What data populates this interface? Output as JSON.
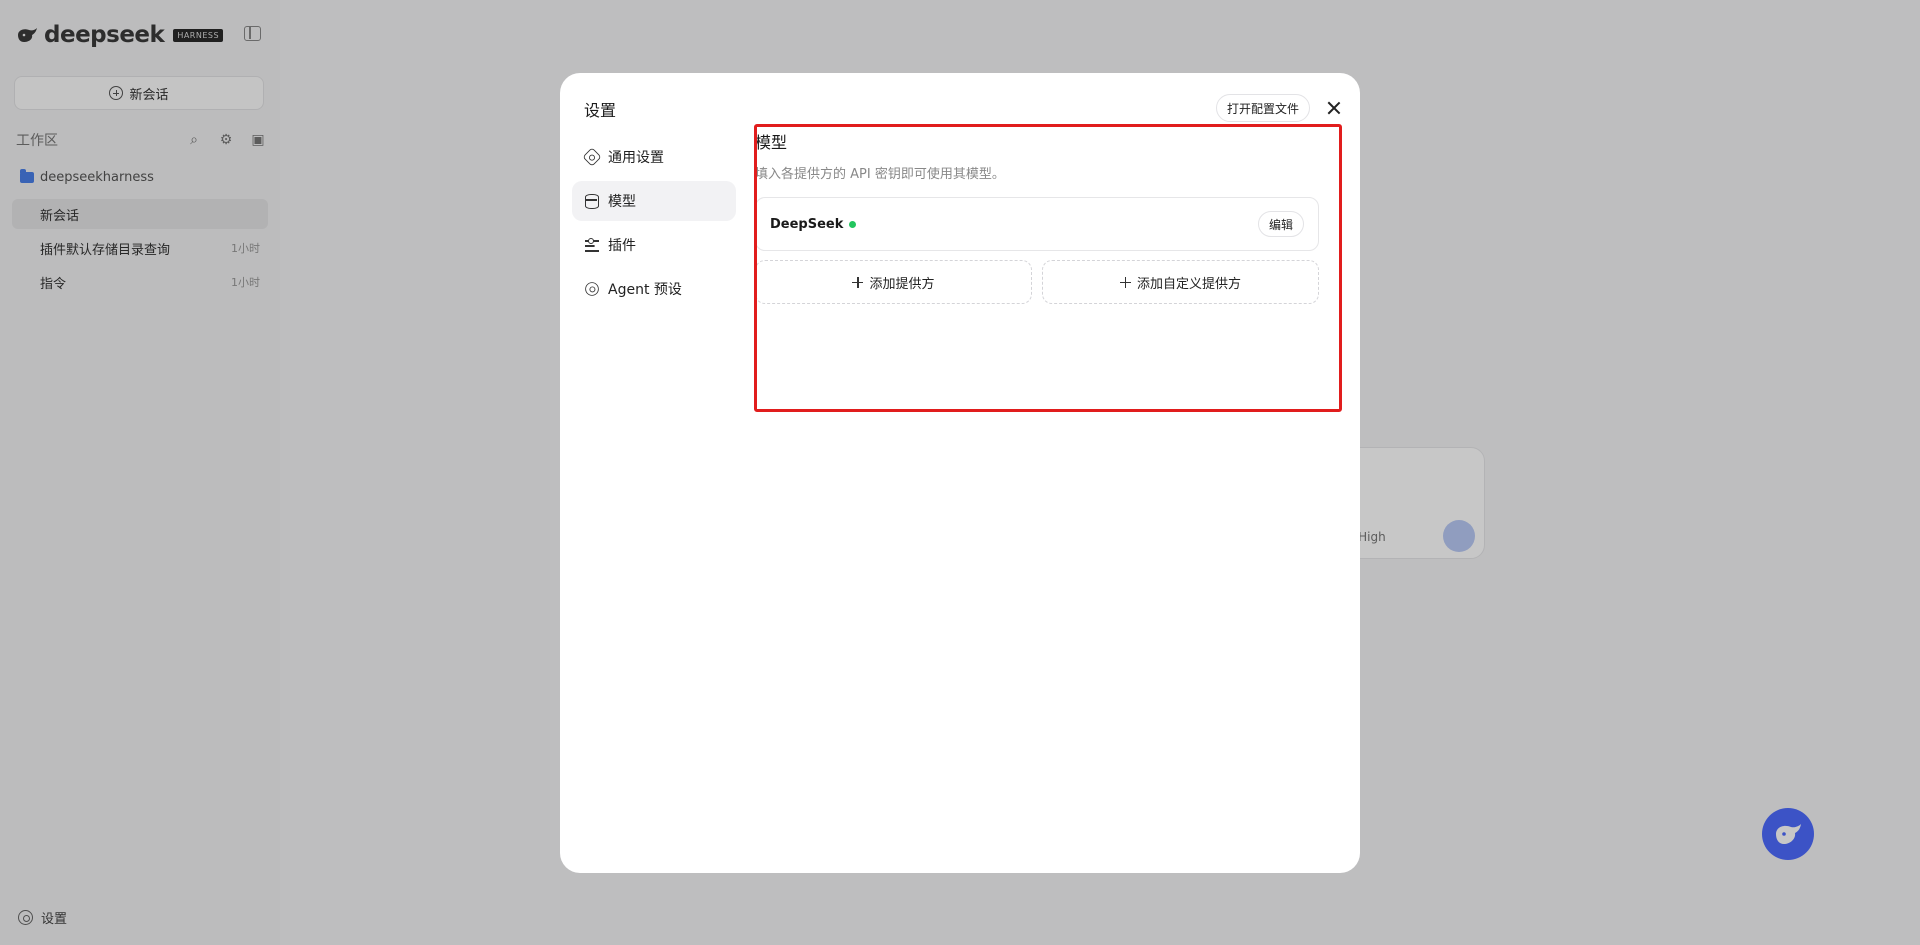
{
  "sidebar": {
    "logo_text": "deepseek",
    "logo_badge": "HARNESS",
    "new_chat_label": "新会话",
    "workspace_label": "工作区",
    "folder_name": "deepseekharness",
    "sessions": [
      {
        "title": "新会话",
        "time": ""
      },
      {
        "title": "插件默认存储目录查询",
        "time": "1小时"
      },
      {
        "title": "指令",
        "time": "1小时"
      }
    ],
    "settings_label": "设置"
  },
  "background": {
    "model_selector": "ek High"
  },
  "modal": {
    "title": "设置",
    "open_config_label": "打开配置文件",
    "nav": [
      {
        "label": "通用设置",
        "icon": "gear-icon"
      },
      {
        "label": "模型",
        "icon": "database-icon"
      },
      {
        "label": "插件",
        "icon": "sliders-icon"
      },
      {
        "label": "Agent 预设",
        "icon": "agent-icon"
      }
    ],
    "active_nav": "模型",
    "section": {
      "title": "模型",
      "description": "填入各提供方的 API 密钥即可使用其模型。",
      "providers": [
        {
          "name": "DeepSeek",
          "status_color": "#22c55e",
          "edit_label": "编辑"
        }
      ],
      "add_provider_label": "添加提供方",
      "add_custom_provider_label": "添加自定义提供方"
    }
  },
  "colors": {
    "accent": "#4d6bfe",
    "highlight": "#e11d1d"
  }
}
